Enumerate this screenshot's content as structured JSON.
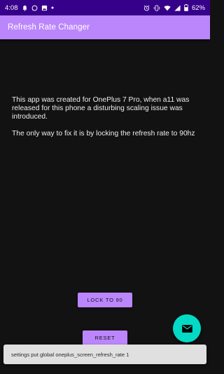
{
  "status_bar": {
    "time": "4:08",
    "battery": "62%",
    "background": "#37008b",
    "left_icons": [
      "bell-icon",
      "whatsapp-icon",
      "gallery-icon",
      "dot-icon"
    ],
    "right_icons": [
      "alarm-icon",
      "vibrate-icon",
      "wifi-icon",
      "signal-icon",
      "battery-icon"
    ]
  },
  "app_bar": {
    "title": "Refresh Rate Changer",
    "background": "#bb86fc"
  },
  "main": {
    "message_1": "This app was created for OnePlus 7 Pro, when a11 was released for this phone a disturbing scaling issue was introduced.",
    "message_2": " The only way to fix it is by locking the refresh rate to 90hz"
  },
  "buttons": {
    "lock_label": "LOCK TO 90",
    "reset_label": "RESET",
    "accent": "#bb86fc"
  },
  "fab": {
    "icon": "email-icon",
    "color": "#03dac5"
  },
  "snackbar": {
    "text": "settings put global oneplus_screen_refresh_rate 1"
  }
}
